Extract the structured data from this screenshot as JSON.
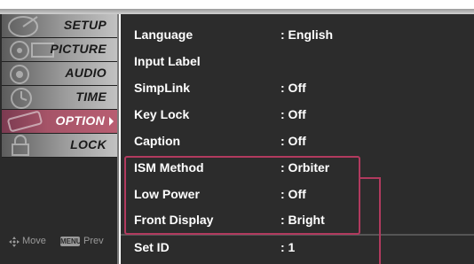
{
  "sidebar": {
    "items": [
      {
        "label": "SETUP",
        "active": false
      },
      {
        "label": "PICTURE",
        "active": false
      },
      {
        "label": "AUDIO",
        "active": false
      },
      {
        "label": "TIME",
        "active": false
      },
      {
        "label": "OPTION",
        "active": true
      },
      {
        "label": "LOCK",
        "active": false
      }
    ],
    "footer": {
      "move_label": "Move",
      "menu_key_label": "MENU",
      "prev_label": "Prev"
    }
  },
  "option_menu": {
    "rows": [
      {
        "label": "Language",
        "value": ": English"
      },
      {
        "label": "Input Label",
        "value": ""
      },
      {
        "label": "SimpLink",
        "value": ": Off"
      },
      {
        "label": "Key Lock",
        "value": ": Off"
      },
      {
        "label": "Caption",
        "value": ": Off"
      },
      {
        "label": "ISM Method",
        "value": ": Orbiter"
      },
      {
        "label": "Low Power",
        "value": ": Off"
      },
      {
        "label": "Front Display",
        "value": ": Bright"
      },
      {
        "label": "Set ID",
        "value": ": 1"
      }
    ]
  },
  "colors": {
    "highlight": "#b13a5e",
    "active_tab": "#a65468",
    "panel_bg": "#2c2c2c"
  }
}
